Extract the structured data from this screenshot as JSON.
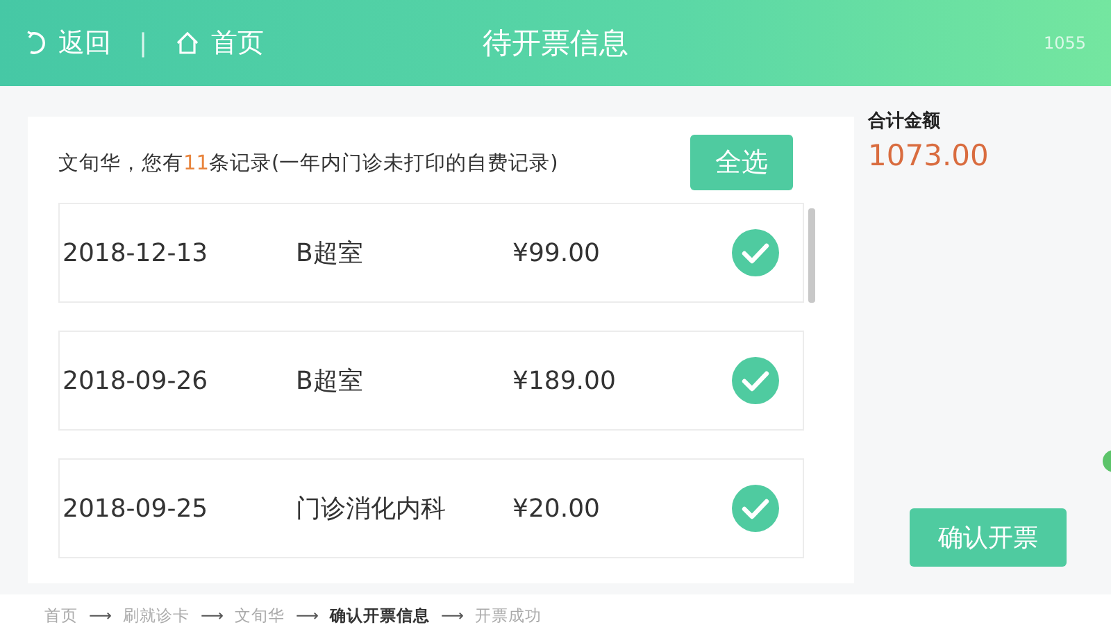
{
  "header": {
    "back_label": "返回",
    "separator": "|",
    "home_label": "首页",
    "title": "待开票信息",
    "code": "1055"
  },
  "records": {
    "intro_prefix": "文旬华，您有",
    "count": "11",
    "intro_suffix": "条记录(一年内门诊未打印的自费记录)",
    "select_all": "全选",
    "rows": [
      {
        "date": "2018-12-13",
        "department": "B超室",
        "amount": "¥99.00",
        "selected": true
      },
      {
        "date": "2018-09-26",
        "department": "B超室",
        "amount": "¥189.00",
        "selected": true
      },
      {
        "date": "2018-09-25",
        "department": "门诊消化内科",
        "amount": "¥20.00",
        "selected": true
      }
    ]
  },
  "summary": {
    "label": "合计金额",
    "total": "1073.00",
    "confirm": "确认开票"
  },
  "breadcrumb": [
    {
      "label": "首页",
      "current": false
    },
    {
      "label": "刷就诊卡",
      "current": false
    },
    {
      "label": "文旬华",
      "current": false
    },
    {
      "label": "确认开票信息",
      "current": true
    },
    {
      "label": "开票成功",
      "current": false
    }
  ],
  "breadcrumb_arrow": "⟶"
}
